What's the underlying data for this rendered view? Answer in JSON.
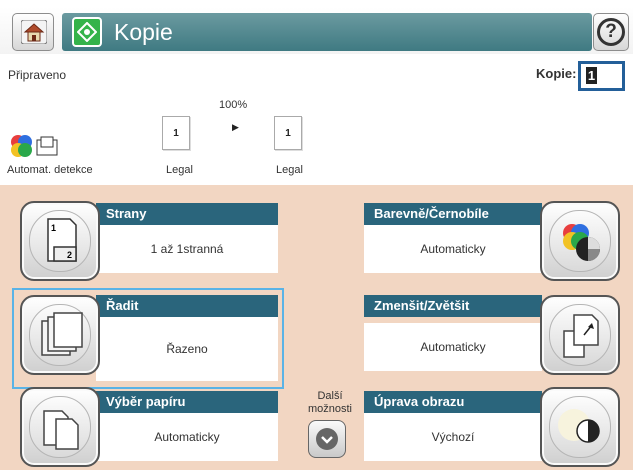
{
  "header": {
    "title": "Kopie",
    "home_icon": "home-icon",
    "app_icon": "copy-icon",
    "help_icon": "help-icon",
    "help_glyph": "?",
    "accent": "#3f7a82"
  },
  "status": {
    "text": "Připraveno",
    "copies_label": "Kopie:",
    "copies_value": "1",
    "scale": "100%",
    "detect_label": "Automat. detekce",
    "source_page": "1",
    "source_label": "Legal",
    "output_page": "1",
    "output_label": "Legal"
  },
  "tiles": [
    {
      "title": "Strany",
      "value": "1 až 1stranná",
      "icon": "sides-icon"
    },
    {
      "title": "Řadit",
      "value": "Řazeno",
      "icon": "collate-icon",
      "selected": true
    },
    {
      "title": "Výběr papíru",
      "value": "Automaticky",
      "icon": "paper-select-icon"
    },
    {
      "title": "Barevně/Černobíle",
      "value": "Automaticky",
      "icon": "color-icon"
    },
    {
      "title": "Zmenšit/Zvětšit",
      "value": "Automaticky",
      "icon": "reduce-enlarge-icon"
    },
    {
      "title": "Úprava obrazu",
      "value": "Výchozí",
      "icon": "image-adjust-icon"
    }
  ],
  "more_options": {
    "label_line1": "Další",
    "label_line2": "možnosti",
    "icon": "chevron-down-icon"
  }
}
